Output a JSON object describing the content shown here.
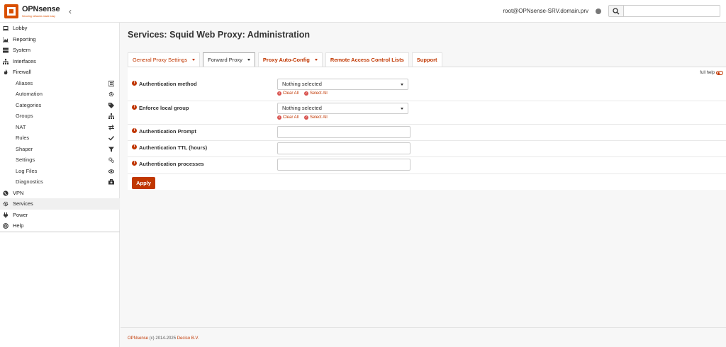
{
  "brand": {
    "name": "OPNsense",
    "tagline": "Securing networks made easy",
    "accent": "#c03600"
  },
  "header": {
    "user": "root@OPNsense-SRV.domain.prv",
    "search_placeholder": "",
    "search_icon": "magnifier-icon"
  },
  "sidebar": {
    "items": [
      {
        "label": "Lobby",
        "icon": "laptop-icon"
      },
      {
        "label": "Reporting",
        "icon": "area-chart-icon"
      },
      {
        "label": "System",
        "icon": "server-icon"
      },
      {
        "label": "Interfaces",
        "icon": "sitemap-icon"
      },
      {
        "label": "Firewall",
        "icon": "fire-icon"
      },
      {
        "label": "Aliases",
        "icon": "list-alt-icon"
      },
      {
        "label": "Automation",
        "icon": "cog-icon"
      },
      {
        "label": "Categories",
        "icon": "tags-icon"
      },
      {
        "label": "Groups",
        "icon": "sitemap-icon"
      },
      {
        "label": "NAT",
        "icon": "exchange-icon"
      },
      {
        "label": "Rules",
        "icon": "check-icon"
      },
      {
        "label": "Shaper",
        "icon": "filter-icon"
      },
      {
        "label": "Settings",
        "icon": "cogs-icon"
      },
      {
        "label": "Log Files",
        "icon": "eye-icon"
      },
      {
        "label": "Diagnostics",
        "icon": "medkit-icon"
      },
      {
        "label": "VPN",
        "icon": "globe-icon"
      },
      {
        "label": "Services",
        "icon": "cog-icon"
      },
      {
        "label": "Power",
        "icon": "plug-icon"
      },
      {
        "label": "Help",
        "icon": "life-ring-icon"
      }
    ]
  },
  "main": {
    "title": "Services: Squid Web Proxy: Administration",
    "tabs": [
      {
        "label": "General Proxy Settings"
      },
      {
        "label": "Forward Proxy"
      },
      {
        "label": "Proxy Auto-Config"
      },
      {
        "label": "Remote Access Control Lists"
      },
      {
        "label": "Support"
      }
    ],
    "full_help": "full help",
    "fields": [
      {
        "label": "Authentication method",
        "value": "Nothing selected"
      },
      {
        "label": "Enforce local group",
        "value": "Nothing selected"
      },
      {
        "label": "Authentication Prompt",
        "value": ""
      },
      {
        "label": "Authentication TTL (hours)",
        "value": ""
      },
      {
        "label": "Authentication processes",
        "value": ""
      }
    ],
    "clear_all": "Clear All",
    "select_all": "Select All",
    "apply": "Apply"
  },
  "footer": {
    "brand": "OPNsense",
    "copyright": "(c) 2014-2025",
    "company": "Deciso B.V."
  }
}
